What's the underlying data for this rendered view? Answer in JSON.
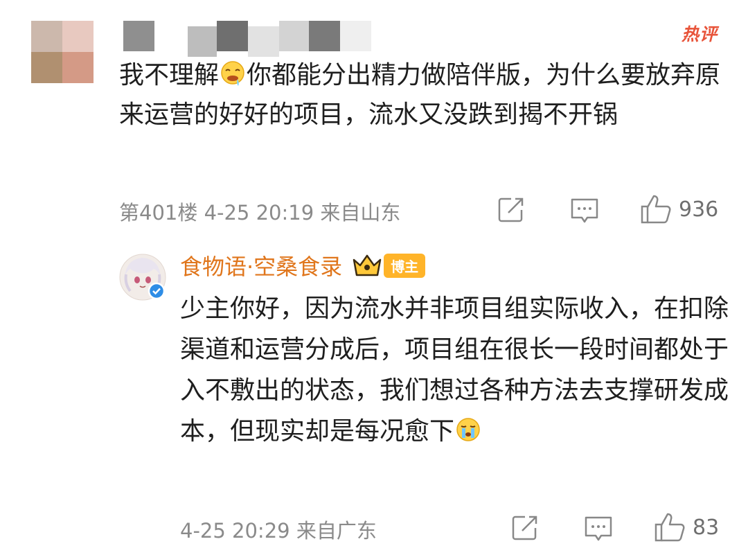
{
  "top_comment": {
    "hot_badge": "热评",
    "text_part1": "我不理解",
    "text_part2": "你都能分出精力做陪伴版，为什么要放弃原来运营的好好的项目，流水又没跌到揭不开锅",
    "emoji_icon": "drool-emoji-icon",
    "meta": "第401楼 4-25 20:19 来自山东",
    "like_count": "936"
  },
  "reply": {
    "author": "食物语·空桑食录",
    "blogger_tag": "博主",
    "text_main": "少主你好，因为流水并非项目组实际收入，在扣除渠道和运营分成后，项目组在很长一段时间都处于入不敷出的状态，我们想过各种方法去支撑研发成本，但现实却是每况愈下",
    "emoji_icon": "crying-emoji-icon",
    "meta": "4-25 20:29 来自广东",
    "like_count": "83"
  },
  "colors": {
    "author_name": "#e0761c",
    "hot_badge": "#e8543a",
    "blogger_tag_bg": "#ffb429",
    "meta_text": "#8a8a8a",
    "verified_badge": "#2e8de6"
  }
}
